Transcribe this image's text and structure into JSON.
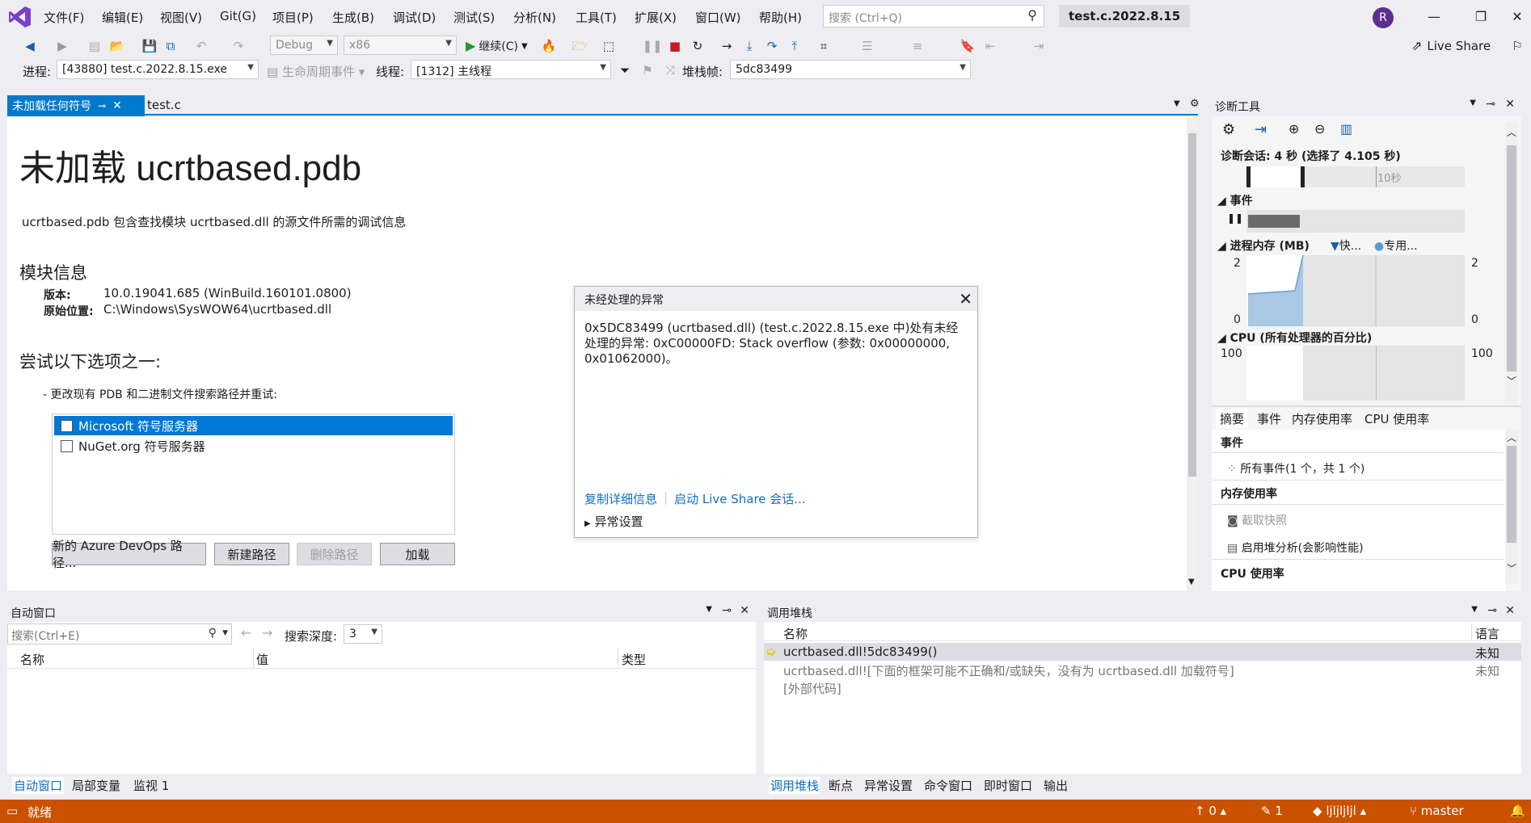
{
  "menubar": {
    "items": [
      "文件(F)",
      "编辑(E)",
      "视图(V)",
      "Git(G)",
      "项目(P)",
      "生成(B)",
      "调试(D)",
      "测试(S)",
      "分析(N)",
      "工具(T)",
      "扩展(X)",
      "窗口(W)",
      "帮助(H)"
    ],
    "search_placeholder": "搜索 (Ctrl+Q)",
    "solution_title": "test.c.2022.8.15",
    "avatar_initial": "R"
  },
  "toolbar": {
    "config": "Debug",
    "platform": "x86",
    "continue_label": "继续(C)",
    "live_share": "Live Share"
  },
  "toolbar2": {
    "process_label": "进程:",
    "process_value": "[43880] test.c.2022.8.15.exe",
    "lifecycle_label": "生命周期事件",
    "thread_label": "线程:",
    "thread_value": "[1312] 主线程",
    "stackframe_label": "堆栈帧:",
    "stackframe_value": "5dc83499"
  },
  "tabs": {
    "active": "未加载任何符号",
    "second": "test.c"
  },
  "doc": {
    "title": "未加载 ucrtbased.pdb",
    "desc": "ucrtbased.pdb 包含查找模块 ucrtbased.dll 的源文件所需的调试信息",
    "module_heading": "模块信息",
    "version_label": "版本:",
    "version_value": "10.0.19041.685 (WinBuild.160101.0800)",
    "origin_label": "原始位置:",
    "origin_value": "C:\\Windows\\SysWOW64\\ucrtbased.dll",
    "try_heading": "尝试以下选项之一:",
    "change_path": "-  更改现有 PDB 和二进制文件搜索路径并重试:",
    "symbol_servers": [
      "Microsoft 符号服务器",
      "NuGet.org 符号服务器"
    ],
    "buttons": [
      "新的 Azure DevOps 路径...",
      "新建路径",
      "删除路径",
      "加载"
    ]
  },
  "exception": {
    "title": "未经处理的异常",
    "message": "0x5DC83499 (ucrtbased.dll) (test.c.2022.8.15.exe 中)处有未经处理的异常: 0xC00000FD: Stack overflow (参数: 0x00000000, 0x01062000)。",
    "copy_link": "复制详细信息",
    "liveshare_link": "启动 Live Share 会话...",
    "settings": "异常设置"
  },
  "diag": {
    "title": "诊断工具",
    "session": "诊断会话: 4 秒 (选择了 4.105 秒)",
    "timeline_tick": "10秒",
    "events_label": "事件",
    "memory_label": "进程内存 (MB)",
    "memory_legend_fast": "快...",
    "memory_legend_private": "专用...",
    "mem_max": "2",
    "mem_min": "0",
    "cpu_label": "CPU (所有处理器的百分比)",
    "cpu_max": "100",
    "tabs": [
      "摘要",
      "事件",
      "内存使用率",
      "CPU 使用率"
    ],
    "sec_events": "事件",
    "all_events": "所有事件(1 个，共 1 个)",
    "sec_memory": "内存使用率",
    "snapshot": "截取快照",
    "heap": "启用堆分析(会影响性能)",
    "sec_cpu": "CPU 使用率"
  },
  "autos": {
    "title": "自动窗口",
    "search_placeholder": "搜索(Ctrl+E)",
    "depth_label": "搜索深度:",
    "depth_value": "3",
    "columns": [
      "名称",
      "值",
      "类型"
    ],
    "tabs": [
      "自动窗口",
      "局部变量",
      "监视 1"
    ]
  },
  "callstack": {
    "title": "调用堆栈",
    "columns": [
      "名称",
      "语言"
    ],
    "rows": [
      {
        "name": "ucrtbased.dll!5dc83499()",
        "lang": "未知"
      },
      {
        "name": "ucrtbased.dll![下面的框架可能不正确和/或缺失，没有为 ucrtbased.dll 加载符号]",
        "lang": "未知"
      },
      {
        "name": "[外部代码]",
        "lang": ""
      }
    ],
    "tabs": [
      "调用堆栈",
      "断点",
      "异常设置",
      "命令窗口",
      "即时窗口",
      "输出"
    ]
  },
  "status": {
    "ready": "就绪",
    "up_count": "0",
    "pencil_count": "1",
    "repo": "ljljljljl",
    "branch": "master"
  }
}
